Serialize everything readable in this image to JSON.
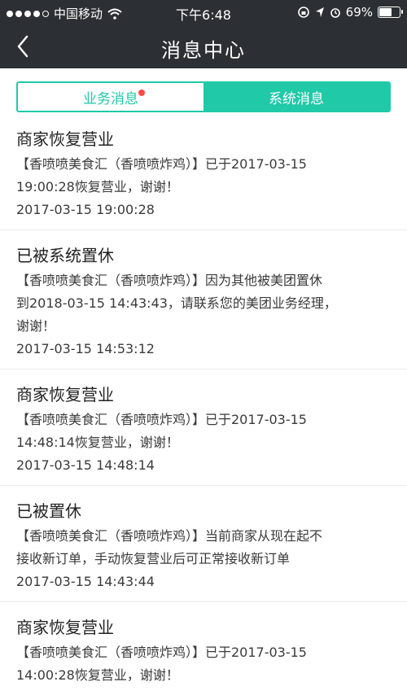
{
  "status_bar": {
    "carrier": "中国移动",
    "time": "下午6:48",
    "battery_percent": "69%",
    "battery_level": 0.69
  },
  "nav": {
    "title": "消息中心",
    "back_icon": "chevron-left-icon"
  },
  "tabs": [
    {
      "label": "业务消息",
      "active": true,
      "has_unread": true
    },
    {
      "label": "系统消息",
      "active": false,
      "has_unread": false
    }
  ],
  "messages": [
    {
      "title": "商家恢复营业",
      "body_lines": [
        "【香喷喷美食汇（香喷喷炸鸡）】已于2017-03-15",
        "19:00:28恢复营业，谢谢！"
      ],
      "time": "2017-03-15 19:00:28"
    },
    {
      "title": "已被系统置休",
      "body_lines": [
        "【香喷喷美食汇（香喷喷炸鸡）】因为其他被美团置休",
        "到2018-03-15 14:43:43，请联系您的美团业务经理，",
        "谢谢！"
      ],
      "time": "2017-03-15 14:53:12"
    },
    {
      "title": "商家恢复营业",
      "body_lines": [
        "【香喷喷美食汇（香喷喷炸鸡）】已于2017-03-15",
        "14:48:14恢复营业，谢谢！"
      ],
      "time": "2017-03-15 14:48:14"
    },
    {
      "title": "已被置休",
      "body_lines": [
        "【香喷喷美食汇（香喷喷炸鸡）】当前商家从现在起不",
        "接收新订单，手动恢复营业后可正常接收新订单"
      ],
      "time": "2017-03-15 14:43:44"
    },
    {
      "title": "商家恢复营业",
      "body_lines": [
        "【香喷喷美食汇（香喷喷炸鸡）】已于2017-03-15",
        "14:00:28恢复营业，谢谢！"
      ],
      "time": ""
    }
  ],
  "colors": {
    "accent": "#20c9a7",
    "header_bg": "#2c2f33",
    "badge": "#ff4a4a"
  }
}
